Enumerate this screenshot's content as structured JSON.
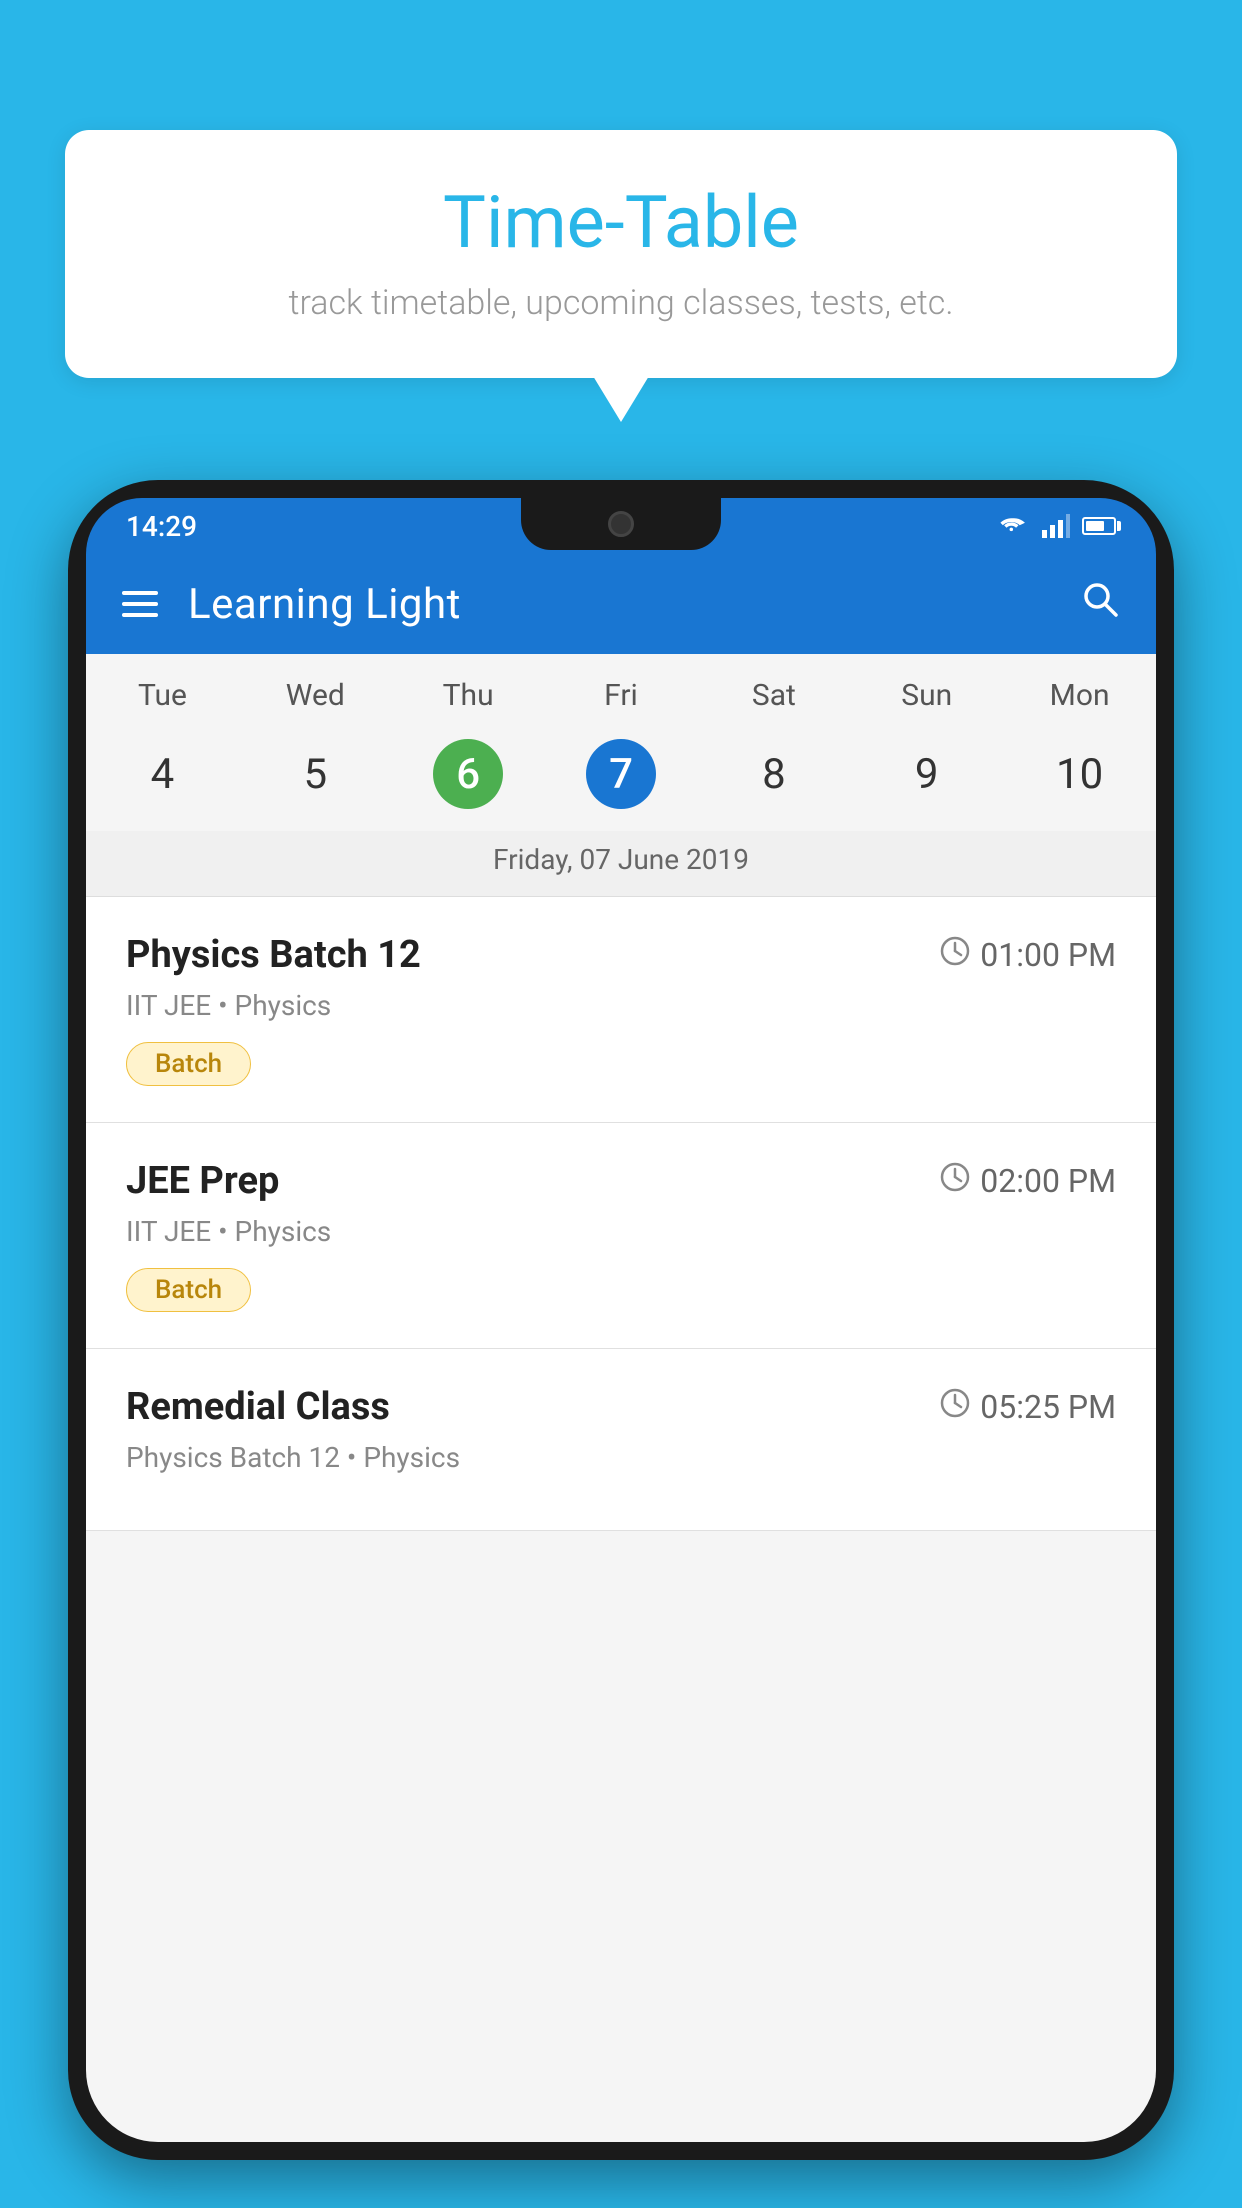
{
  "background_color": "#29B6E8",
  "speech_bubble": {
    "title": "Time-Table",
    "subtitle": "track timetable, upcoming classes, tests, etc."
  },
  "app": {
    "name": "Learning Light",
    "time": "14:29"
  },
  "calendar": {
    "selected_date_label": "Friday, 07 June 2019",
    "weekdays": [
      "Tue",
      "Wed",
      "Thu",
      "Fri",
      "Sat",
      "Sun",
      "Mon"
    ],
    "dates": [
      {
        "value": "4",
        "type": "normal"
      },
      {
        "value": "5",
        "type": "normal"
      },
      {
        "value": "6",
        "type": "green"
      },
      {
        "value": "7",
        "type": "blue"
      },
      {
        "value": "8",
        "type": "normal"
      },
      {
        "value": "9",
        "type": "normal"
      },
      {
        "value": "10",
        "type": "normal"
      }
    ]
  },
  "classes": [
    {
      "name": "Physics Batch 12",
      "time": "01:00 PM",
      "meta": "IIT JEE • Physics",
      "badge": "Batch"
    },
    {
      "name": "JEE Prep",
      "time": "02:00 PM",
      "meta": "IIT JEE • Physics",
      "badge": "Batch"
    },
    {
      "name": "Remedial Class",
      "time": "05:25 PM",
      "meta": "Physics Batch 12 • Physics",
      "badge": ""
    }
  ],
  "icons": {
    "hamburger": "≡",
    "search": "🔍",
    "clock": "⏱"
  }
}
